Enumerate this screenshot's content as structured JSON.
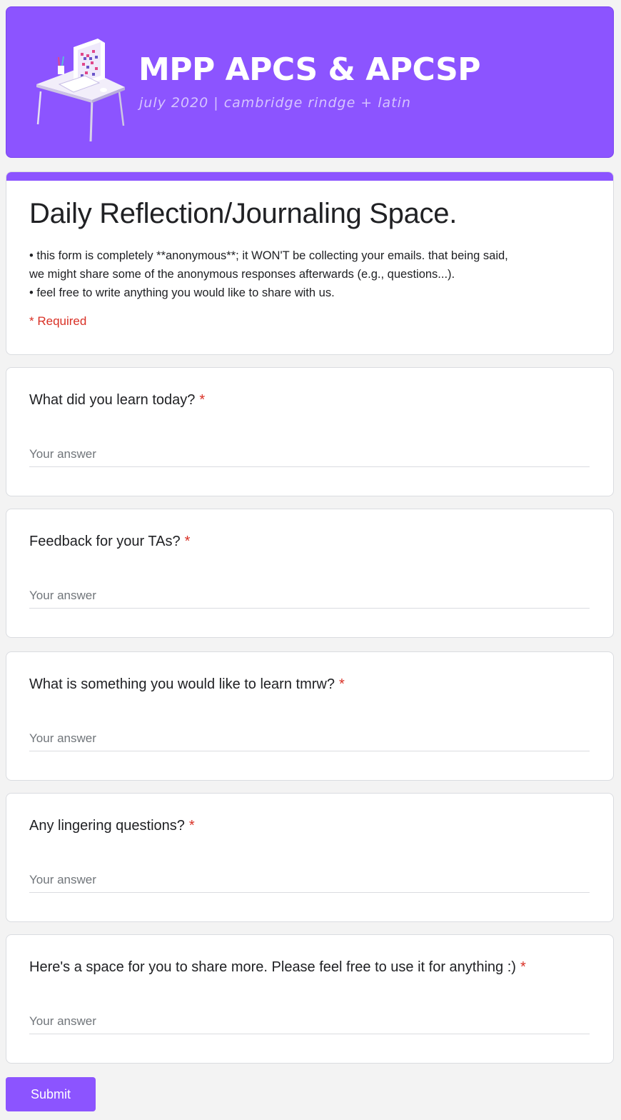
{
  "banner": {
    "title": "MPP APCS & APCSP",
    "subtitle": "july 2020 | cambridge rindge + latin",
    "illustration_icon": "computer-desk-icon"
  },
  "form": {
    "title": "Daily Reflection/Journaling Space.",
    "description_lines": [
      "• this form is completely **anonymous**; it WON'T be collecting your emails. that being said,",
      "we might share some of the anonymous responses afterwards (e.g., questions...).",
      "• feel free to write anything you would like to share with us."
    ],
    "required_note": "* Required"
  },
  "questions": [
    {
      "title": "What did you learn today?",
      "required_mark": "*",
      "placeholder": "Your answer"
    },
    {
      "title": "Feedback for your TAs?",
      "required_mark": "*",
      "placeholder": "Your answer"
    },
    {
      "title": "What is something you would like to learn tmrw?",
      "required_mark": "*",
      "placeholder": "Your answer"
    },
    {
      "title": "Any lingering questions?",
      "required_mark": "*",
      "placeholder": "Your answer"
    },
    {
      "title": "Here's a space for you to share more. Please feel free to use it for anything :)",
      "required_mark": "*",
      "placeholder": "Your answer"
    }
  ],
  "submit_label": "Submit",
  "colors": {
    "accent": "#8c54ff",
    "required": "#d93025",
    "background": "#f3f3f3"
  }
}
